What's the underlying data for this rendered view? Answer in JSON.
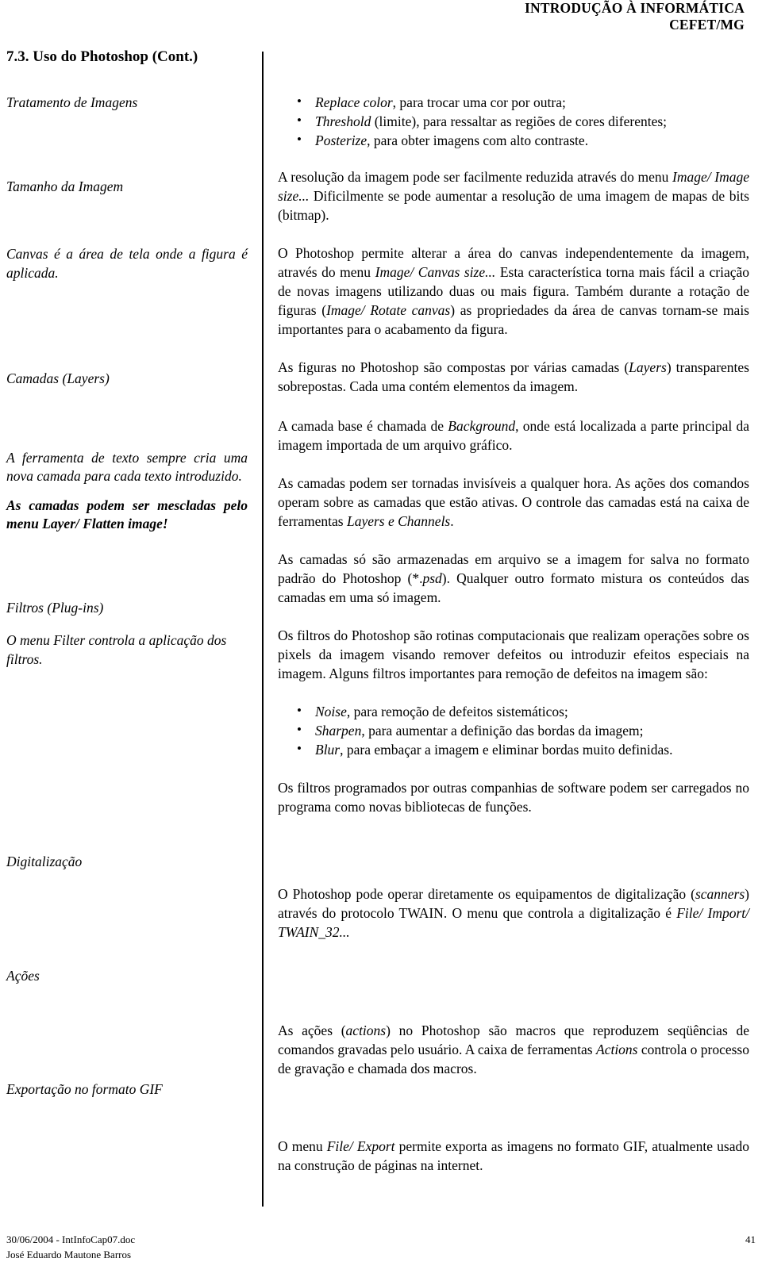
{
  "header": {
    "line1": "INTRODUÇÃO À INFORMÁTICA",
    "line2": "CEFET/MG"
  },
  "left_column": {
    "section_heading": "7.3. Uso do Photoshop (Cont.)",
    "notes": [
      {
        "text": "Tratamento de Imagens"
      },
      {
        "text": "Tamanho da Imagem"
      },
      {
        "text": "Canvas é a área de tela onde a figura é aplicada."
      },
      {
        "text": "Camadas (Layers)"
      },
      {
        "text": "A ferramenta de texto sempre cria uma nova camada para cada texto introduzido."
      },
      {
        "text": "As camadas podem ser mescladas pelo menu Layer/ Flatten image!"
      },
      {
        "text": "Filtros (Plug-ins)"
      },
      {
        "text": "O menu Filter controla a aplicação dos filtros."
      },
      {
        "text": "Digitalização"
      },
      {
        "text": "Ações"
      },
      {
        "text": "Exportação no formato GIF"
      }
    ]
  },
  "right_column": {
    "bullets_top": [
      {
        "term": "Replace color",
        "rest": ", para trocar uma cor por outra;"
      },
      {
        "term": "Threshold",
        "rest": " (limite), para ressaltar as regiões de cores diferentes;"
      },
      {
        "term": "Posterize",
        "rest": ", para obter imagens com alto contraste."
      }
    ],
    "p_resolucao_a": "A resolução da imagem pode ser facilmente reduzida através do menu ",
    "p_resolucao_em": "Image/ Image size...",
    "p_resolucao_b": " Dificilmente se pode aumentar a resolução de uma imagem de mapas de bits (bitmap).",
    "p_canvas_a": "O Photoshop permite alterar a área do canvas independentemente da imagem, através do menu ",
    "p_canvas_em1": "Image/ Canvas size...",
    "p_canvas_b": " Esta característica torna mais fácil a criação de novas imagens utilizando duas ou mais figura. Também durante a rotação de figuras (",
    "p_canvas_em2": "Image/ Rotate canvas",
    "p_canvas_c": ") as propriedades da área de canvas tornam-se mais importantes para o acabamento da figura.",
    "p_figuras_a": "As figuras no Photoshop são compostas por várias camadas (",
    "p_figuras_em": "Layers",
    "p_figuras_b": ") transparentes sobrepostas. Cada uma contém elementos da imagem.",
    "p_background_a": "A camada base é chamada de ",
    "p_background_em": "Background",
    "p_background_b": ", onde está localizada a parte principal da imagem importada de um arquivo gráfico.",
    "p_invisiveis_a": "As camadas podem ser tornadas invisíveis a qualquer hora. As ações dos comandos operam sobre as camadas que estão ativas. O controle das camadas está na caixa de ferramentas ",
    "p_invisiveis_em": "Layers e Channels",
    "p_invisiveis_b": ".",
    "p_psd_a": "As camadas só são armazenadas em arquivo se a imagem for salva no formato padrão do Photoshop (*.",
    "p_psd_em": "psd",
    "p_psd_b": "). Qualquer outro formato mistura os conteúdos das camadas em uma só imagem.",
    "p_filtros": "Os filtros do Photoshop são rotinas computacionais que realizam operações sobre os pixels da imagem visando remover defeitos ou introduzir efeitos especiais na imagem. Alguns filtros importantes para remoção de defeitos na imagem são:",
    "bullets_filtros": [
      {
        "term": "Noise",
        "rest": ", para remoção de defeitos sistemáticos;"
      },
      {
        "term": "Sharpen",
        "rest": ", para aumentar a definição das bordas da imagem;"
      },
      {
        "term": "Blur",
        "rest": ", para embaçar a imagem e eliminar bordas muito definidas."
      }
    ],
    "p_programados": "Os filtros programados por outras companhias de software podem ser carregados no programa como novas bibliotecas de funções.",
    "p_twain_a": "O Photoshop pode operar diretamente os equipamentos de digitalização (",
    "p_twain_em1": "scanners",
    "p_twain_b": ") através do protocolo TWAIN. O menu que controla a digitalização é ",
    "p_twain_em2": "File/ Import/ TWAIN_32...",
    "p_acoes_a": "As ações (",
    "p_acoes_em1": "actions",
    "p_acoes_b": ") no Photoshop são macros que reproduzem seqüências de comandos gravadas pelo usuário. A caixa de ferramentas ",
    "p_acoes_em2": "Actions",
    "p_acoes_c": " controla o processo de gravação e chamada dos macros.",
    "p_export_a": "O menu ",
    "p_export_em": "File/ Export",
    "p_export_b": " permite exporta as imagens no formato GIF, atualmente usado na construção de páginas na internet."
  },
  "footer": {
    "line1": "30/06/2004 - IntInfoCap07.doc",
    "line2": "José Eduardo Mautone Barros",
    "page_number": "41"
  }
}
